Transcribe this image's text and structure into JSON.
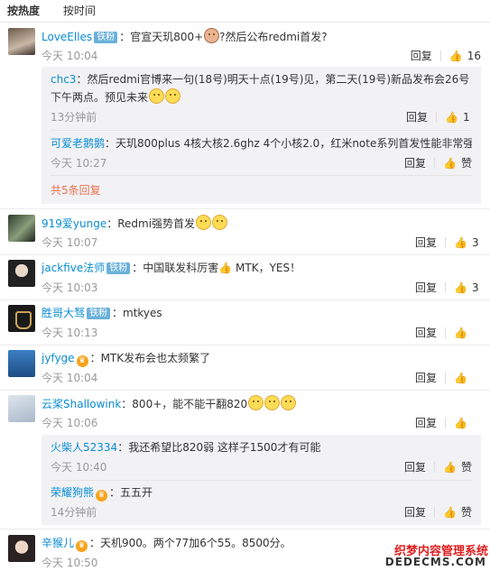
{
  "tabs": [
    "按热度",
    "按时间"
  ],
  "comments": [
    {
      "user": "LoveElles",
      "badge": "铁粉",
      "text_a": "：官宣天玑800+",
      "text_b": "?然后公布redmi首发?",
      "time": "今天 10:04",
      "reply": "回复",
      "likes": "16"
    },
    {
      "user": "919爱yunge",
      "text": "：Redmi强势首发",
      "time": "今天 10:07",
      "reply": "回复",
      "likes": "3"
    },
    {
      "user": "jackfive法师",
      "badge": "铁粉",
      "text": "：中国联发科厉害👍 MTK，YES！",
      "time": "今天 10:03",
      "reply": "回复",
      "likes": "3"
    },
    {
      "user": "胜哥大驽",
      "badge": "铁粉",
      "text": "：mtkyes",
      "time": "今天 10:13",
      "reply": "回复",
      "likes": ""
    },
    {
      "user": "jyfyge",
      "vip": "♛",
      "text": "：MTK发布会也太频繁了",
      "time": "今天 10:04",
      "reply": "回复",
      "likes": ""
    },
    {
      "user": "云桨Shallowink",
      "text": "：800+，能不能干翻820",
      "time": "今天 10:06",
      "reply": "回复",
      "likes": ""
    },
    {
      "user": "辛猴儿",
      "vip": "♛",
      "text": "：天机900。两个77加6个55。8500分。",
      "time": "今天 10:50",
      "reply": "回复",
      "likes": ""
    }
  ],
  "subs1": [
    {
      "user": "chc3",
      "text": "：然后redmi官博来一句(18号)明天十点(19号)见，第二天(19号)新品发布会26号下午两点。预见未来",
      "time": "13分钟前",
      "reply": "回复",
      "likes": "1"
    },
    {
      "user": "可爱老鹅鹅",
      "text": "：天玑800plus 4核大核2.6ghz 4个小核2.0，红米note系列首发性能非常强",
      "time": "今天 10:27",
      "reply": "回复",
      "likes": "赞"
    }
  ],
  "more1": "共5条回复",
  "subs2": [
    {
      "user": "火柴人52334",
      "text": "：我还希望比820弱 这样子1500才有可能",
      "time": "今天 10:40",
      "reply": "回复",
      "likes": "赞"
    },
    {
      "user": "荣耀狗熊",
      "vip": "♛",
      "text": "：五五开",
      "time": "14分钟前",
      "reply": "回复",
      "likes": "赞"
    }
  ],
  "watermark": {
    "line1": "织梦内容管理系统",
    "line2": "DEDECMS.COM"
  },
  "colors": {
    "username": "#eb7350",
    "subname": "#0a8cd2",
    "subbg": "#f2f2f5"
  }
}
